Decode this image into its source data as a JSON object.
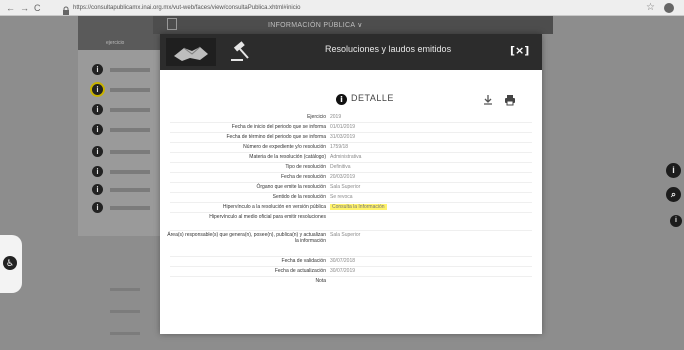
{
  "browser": {
    "url": "https://consultapublicamx.inai.org.mx/vut-web/faces/view/consultaPublica.xhtml#inicio",
    "nav": [
      "←",
      "→",
      "C"
    ]
  },
  "background": {
    "top_title": "INFORMACIÓN PÚBLICA ∨",
    "left_header_label": "ejercicio",
    "left_rows": [
      "2019",
      "2019",
      "2019",
      "2019",
      "2019",
      "2019",
      "2019",
      "2019"
    ],
    "right_icons": [
      "i",
      "search",
      "i"
    ]
  },
  "modal": {
    "title": "Resoluciones y laudos emitidos",
    "close_label": "[×]",
    "detail_title": "DETALLE",
    "rows": [
      {
        "label": "Ejercicio",
        "value": "2019"
      },
      {
        "label": "Fecha de inicio del periodo que se informa",
        "value": "01/01/2019"
      },
      {
        "label": "Fecha de término del periodo que se informa",
        "value": "31/03/2019"
      },
      {
        "label": "Número de expediente y/o resolución",
        "value": "1759/18"
      },
      {
        "label": "Materia de la resolución (catálogo)",
        "value": "Administrativa"
      },
      {
        "label": "Tipo de resolución",
        "value": "Definitiva"
      },
      {
        "label": "Fecha de resolución",
        "value": "20/03/2019"
      },
      {
        "label": "Órgano que emite la resolución",
        "value": "Sala Superior"
      },
      {
        "label": "Sentido de la resolución",
        "value": "Se revoca"
      },
      {
        "label": "Hipervínculo a la resolución en versión pública",
        "value": "Consulta la Información",
        "highlight": true
      },
      {
        "label": "Hipervínculo al medio oficial para emitir resoluciones",
        "value": ""
      },
      {
        "label": "Área(s) responsable(s) que genera(n), posee(n), publica(n) y actualizan la información",
        "value": "Sala Superior"
      },
      {
        "label": "Fecha de validación",
        "value": "30/07/2018"
      },
      {
        "label": "Fecha de actualización",
        "value": "30/07/2019"
      },
      {
        "label": "Nota",
        "value": ""
      }
    ]
  }
}
